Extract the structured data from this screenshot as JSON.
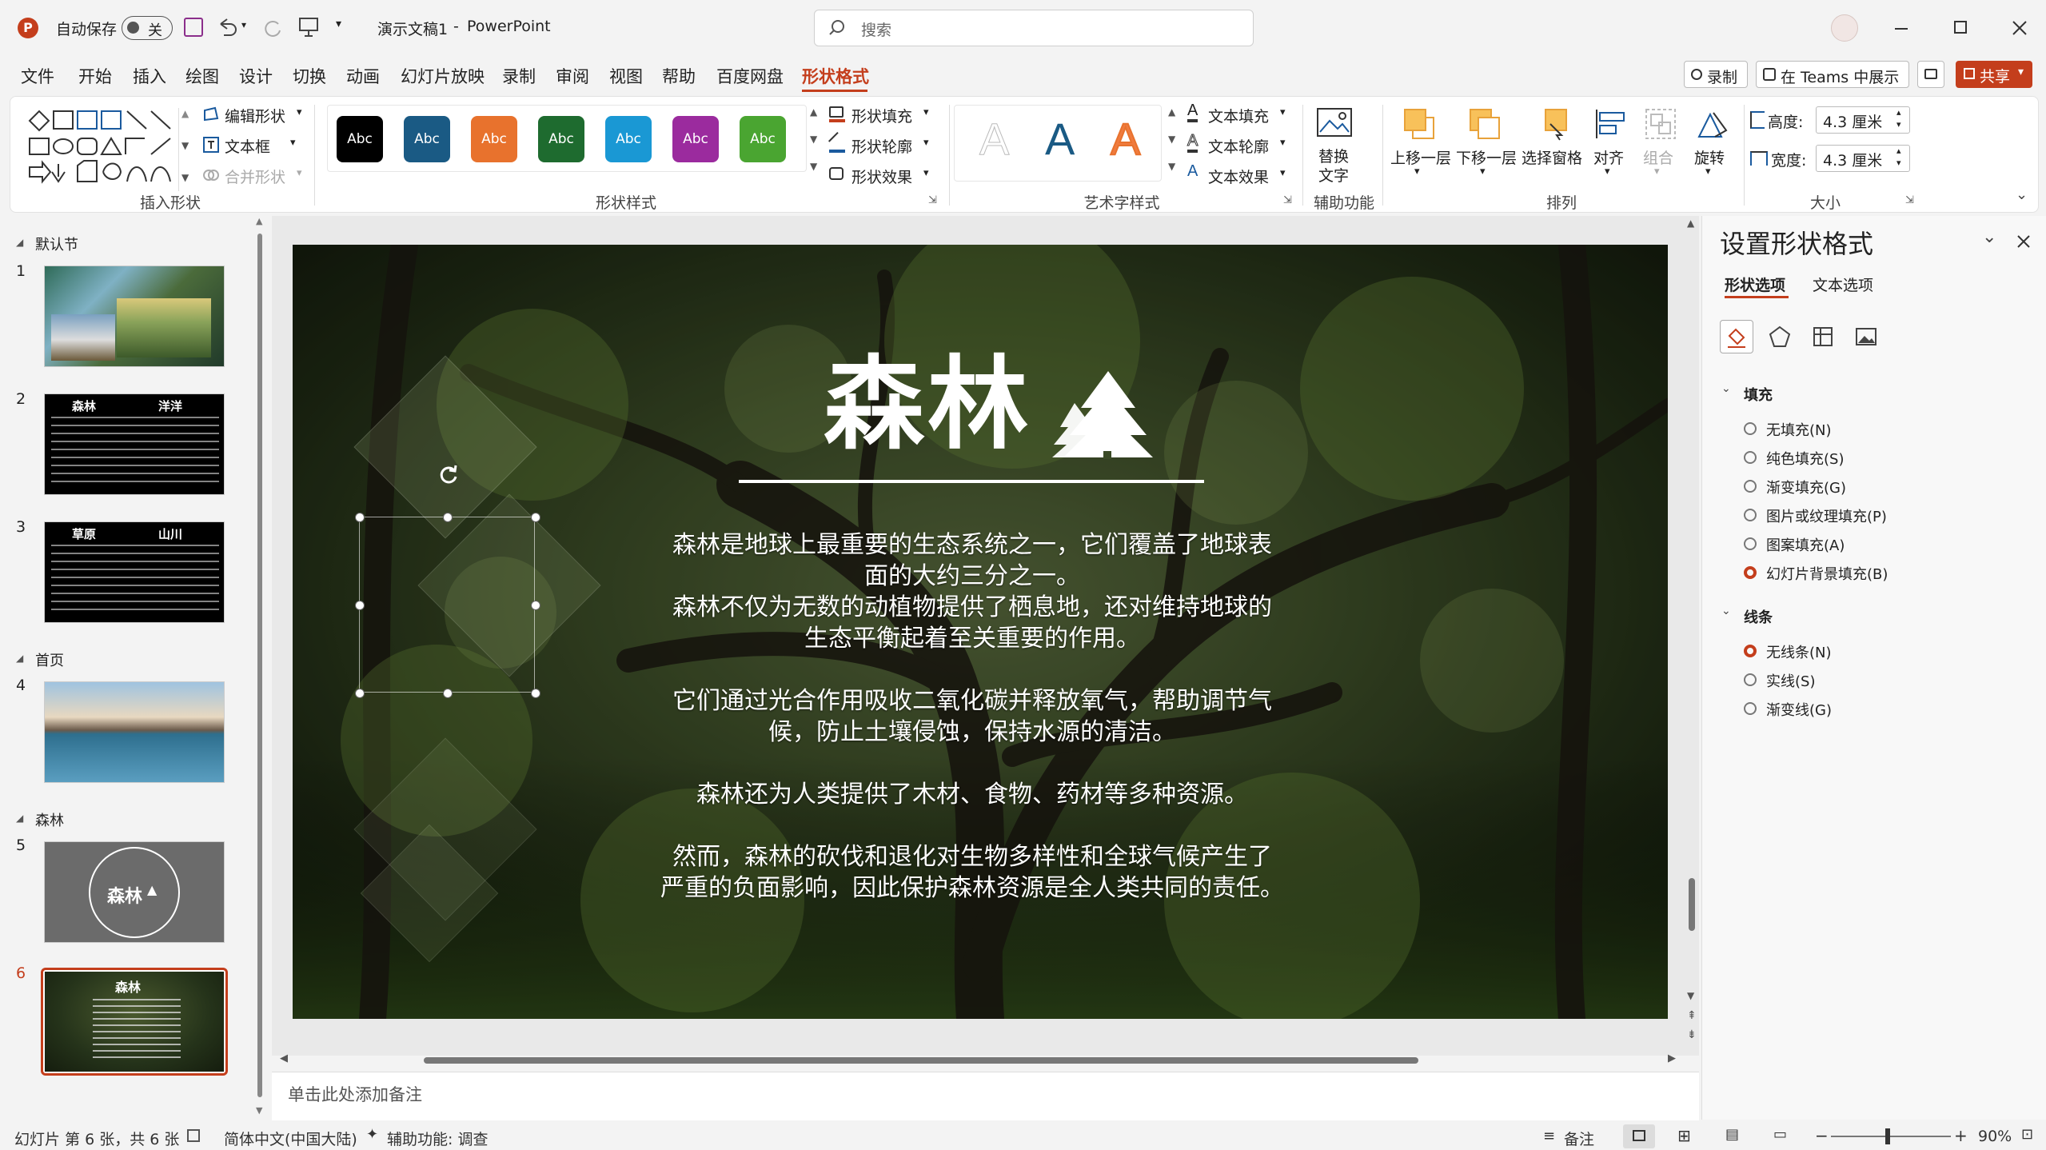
{
  "titlebar": {
    "autosave_label": "自动保存",
    "autosave_state": "关",
    "doc_title": "演示文稿1",
    "separator": "-",
    "app_name": "PowerPoint",
    "search_placeholder": "搜索"
  },
  "menu": {
    "items": [
      "文件",
      "开始",
      "插入",
      "绘图",
      "设计",
      "切换",
      "动画",
      "幻灯片放映",
      "录制",
      "审阅",
      "视图",
      "帮助",
      "百度网盘",
      "形状格式"
    ],
    "active": "形状格式",
    "record_label": "录制",
    "teams_label": "在 Teams 中展示",
    "share_label": "共享"
  },
  "ribbon": {
    "insert_shape": {
      "edit_shape": "编辑形状",
      "textbox": "文本框",
      "merge_shapes": "合并形状",
      "label": "插入形状"
    },
    "shape_styles": {
      "swatch_text": "Abc",
      "fill": "形状填充",
      "outline": "形状轮廓",
      "effects": "形状效果",
      "label": "形状样式"
    },
    "swatches": [
      "#000000",
      "#1a5a84",
      "#e8722d",
      "#1e6b2f",
      "#1a98d4",
      "#9b2b9e",
      "#4aa531"
    ],
    "wordart": {
      "glyph": "A",
      "text_fill": "文本填充",
      "text_outline": "文本轮廓",
      "text_effects": "文本效果",
      "label": "艺术字样式"
    },
    "accessibility": {
      "alt_text_line1": "替换",
      "alt_text_line2": "文字",
      "label": "辅助功能"
    },
    "arrange": {
      "bring_forward": "上移一层",
      "send_backward": "下移一层",
      "selection_pane": "选择窗格",
      "align": "对齐",
      "group": "组合",
      "rotate": "旋转",
      "label": "排列"
    },
    "size": {
      "height_label": "高度:",
      "height_value": "4.3 厘米",
      "width_label": "宽度:",
      "width_value": "4.3 厘米",
      "label": "大小"
    }
  },
  "thumbnails": {
    "sections": [
      {
        "name": "默认节"
      },
      {
        "name": "首页"
      },
      {
        "name": "森林"
      }
    ],
    "slides": [
      {
        "number": "1"
      },
      {
        "number": "2",
        "title_left": "森林",
        "title_right": "洋洋"
      },
      {
        "number": "3",
        "title_left": "草原",
        "title_right": "山川"
      },
      {
        "number": "4"
      },
      {
        "number": "5",
        "circle_text": "森林"
      },
      {
        "number": "6",
        "title": "森林"
      }
    ]
  },
  "slide": {
    "title": "森林",
    "p1_l1": "森林是地球上最重要的生态系统之一，它们覆盖了地球表",
    "p1_l2": "面的大约三分之一。",
    "p1_l3": "森林不仅为无数的动植物提供了栖息地，还对维持地球的",
    "p1_l4": "生态平衡起着至关重要的作用。",
    "p2_l1": "它们通过光合作用吸收二氧化碳并释放氧气，帮助调节气",
    "p2_l2": "候，防止土壤侵蚀，保持水源的清洁。",
    "p3_l1": "森林还为人类提供了木材、食物、药材等多种资源。",
    "p4_l1": "然而，森林的砍伐和退化对生物多样性和全球气候产生了",
    "p4_l2": "严重的负面影响，因此保护森林资源是全人类共同的责任。"
  },
  "notes_placeholder": "单击此处添加备注",
  "format_pane": {
    "title": "设置形状格式",
    "tab_shape": "形状选项",
    "tab_text": "文本选项",
    "fill_section": "填充",
    "fill_options": [
      "无填充(N)",
      "纯色填充(S)",
      "渐变填充(G)",
      "图片或纹理填充(P)",
      "图案填充(A)",
      "幻灯片背景填充(B)"
    ],
    "fill_selected": 5,
    "line_section": "线条",
    "line_options": [
      "无线条(N)",
      "实线(S)",
      "渐变线(G)"
    ],
    "line_selected": 0
  },
  "statusbar": {
    "slide_info": "幻灯片 第 6 张，共 6 张",
    "language": "简体中文(中国大陆)",
    "accessibility": "辅助功能: 调查",
    "notes": "备注",
    "zoom": "90%"
  },
  "colors": {
    "accent": "#c43e1c",
    "forest_dark": "#1f2a14"
  }
}
